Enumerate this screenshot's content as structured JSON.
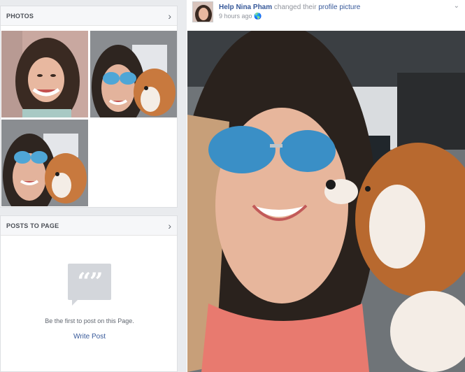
{
  "photos": {
    "title": "PHOTOS",
    "items": [
      {
        "alt": "smiling portrait"
      },
      {
        "alt": "selfie with sunglasses and dog"
      },
      {
        "alt": "selfie with sunglasses and dog"
      }
    ]
  },
  "posts": {
    "title": "POSTS TO PAGE",
    "empty_text": "Be the first to post on this Page.",
    "write_post": "Write Post"
  },
  "post": {
    "author": "Help Nina Pham",
    "action": "changed their",
    "object": "profile picture",
    "time": "9 hours ago"
  },
  "colors": {
    "link": "#365899",
    "muted": "#90949c",
    "background": "#e9ebee"
  }
}
